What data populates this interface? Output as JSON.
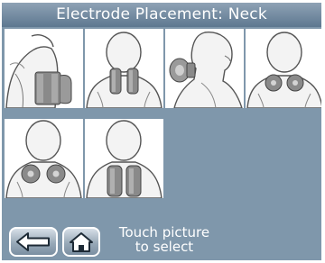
{
  "title": "Electrode Placement: Neck",
  "tiles": [
    {
      "name": "shoulder-wrap"
    },
    {
      "name": "neck-upper-pair"
    },
    {
      "name": "neck-side-profile"
    },
    {
      "name": "shoulder-round-pair"
    },
    {
      "name": "shoulder-round-pair-low"
    },
    {
      "name": "upper-back-pair"
    }
  ],
  "footer": {
    "hint_line1": "Touch picture",
    "hint_line2": "to select",
    "back_icon": "back-arrow-icon",
    "home_icon": "home-icon"
  },
  "colors": {
    "background": "#7f97ab",
    "tile": "#ffffff",
    "electrode": "#8a8a8a"
  }
}
